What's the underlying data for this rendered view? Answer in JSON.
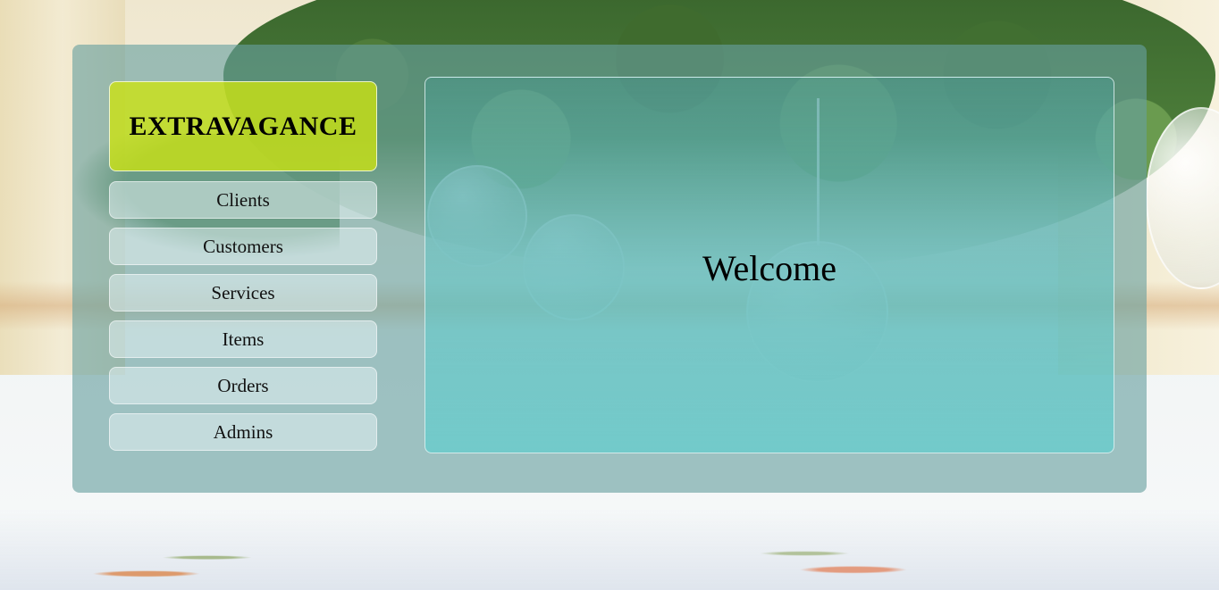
{
  "brand": {
    "name": "EXTRAVAGANCE"
  },
  "nav": {
    "items": [
      {
        "label": "Clients"
      },
      {
        "label": "Customers"
      },
      {
        "label": "Services"
      },
      {
        "label": "Items"
      },
      {
        "label": "Orders"
      },
      {
        "label": "Admins"
      }
    ]
  },
  "main": {
    "heading": "Welcome"
  },
  "colors": {
    "brand_accent": "#cde40f",
    "panel": "#68a0a0",
    "content": "#5fc8c8"
  }
}
